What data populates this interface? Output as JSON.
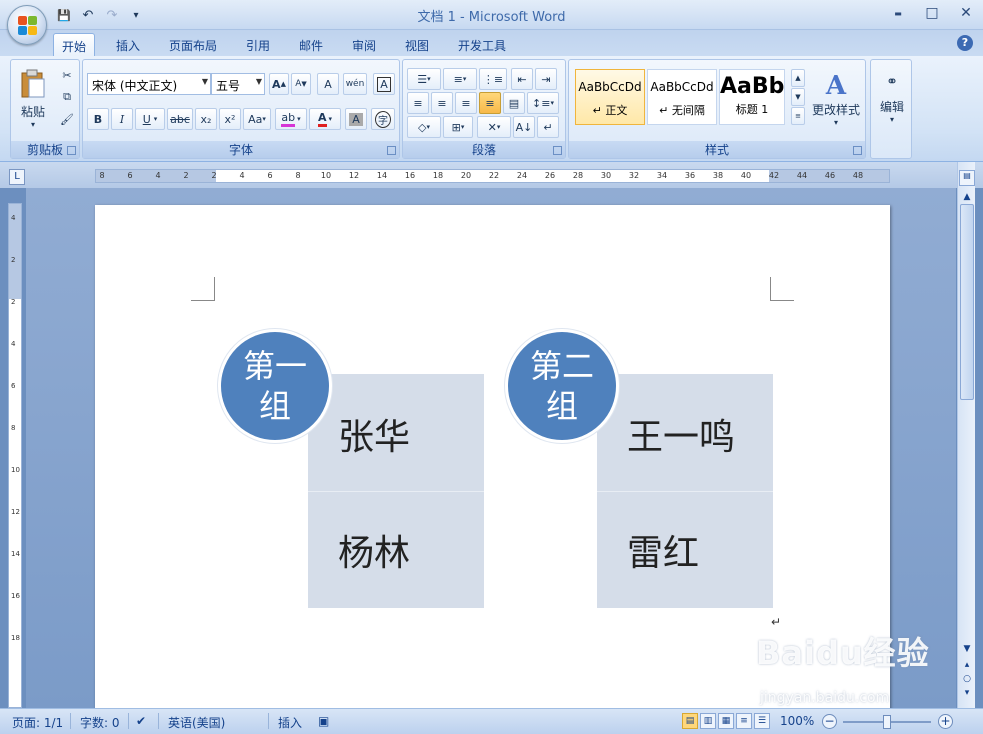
{
  "window": {
    "title": "文档 1 - Microsoft Word",
    "controls": {
      "minimize": "▬",
      "maximize": "□",
      "close": "✕"
    }
  },
  "qat": {
    "save_icon": "💾",
    "undo_icon": "↶",
    "redo_icon": "↷",
    "customize_icon": "▾"
  },
  "tabs": [
    {
      "label": "开始"
    },
    {
      "label": "插入"
    },
    {
      "label": "页面布局"
    },
    {
      "label": "引用"
    },
    {
      "label": "邮件"
    },
    {
      "label": "审阅"
    },
    {
      "label": "视图"
    },
    {
      "label": "开发工具"
    }
  ],
  "ribbon": {
    "clipboard": {
      "label": "剪贴板",
      "paste_label": "粘贴"
    },
    "font": {
      "label": "字体",
      "font_name": "宋体 (中文正文)",
      "font_size": "五号",
      "bold": "B",
      "italic": "I",
      "underline": "U",
      "strike": "abc",
      "subscript": "x₂",
      "superscript": "x²",
      "change_case": "Aa",
      "grow": "A",
      "shrink": "A",
      "clear": "A",
      "phonetic": "wén",
      "border": "A",
      "highlight": "ab",
      "font_color": "A",
      "shading": "A",
      "enclose": "字"
    },
    "paragraph": {
      "label": "段落"
    },
    "styles": {
      "label": "样式",
      "items": [
        {
          "sample": "AaBbCcDd",
          "name": "↵ 正文"
        },
        {
          "sample": "AaBbCcDd",
          "name": "↵ 无间隔"
        },
        {
          "sample": "AaBb",
          "name": "标题 1"
        }
      ],
      "change_styles": "更改样式"
    },
    "editing": {
      "label": "编辑"
    }
  },
  "ruler": {
    "corner": "L",
    "ticks": [
      "8",
      "6",
      "4",
      "2",
      "2",
      "4",
      "6",
      "8",
      "10",
      "12",
      "14",
      "16",
      "18",
      "20",
      "22",
      "24",
      "26",
      "28",
      "30",
      "32",
      "34",
      "36",
      "38",
      "40",
      "42",
      "44",
      "46",
      "48"
    ],
    "vticks": [
      "4",
      "2",
      "2",
      "4",
      "6",
      "8",
      "10",
      "12",
      "14",
      "16",
      "18"
    ]
  },
  "document": {
    "groups": [
      {
        "title": "第一组",
        "members": [
          "张华",
          "杨林"
        ]
      },
      {
        "title": "第二组",
        "members": [
          "王一鸣",
          "雷红"
        ]
      }
    ]
  },
  "status": {
    "page": "页面: 1/1",
    "words": "字数: 0",
    "language": "英语(美国)",
    "mode": "插入",
    "zoom": "100%"
  },
  "watermark": {
    "main": "Baidu经验",
    "sub": "jingyan.baidu.com"
  },
  "colors": {
    "accent": "#4f81bd",
    "box": "#d5dde9"
  }
}
